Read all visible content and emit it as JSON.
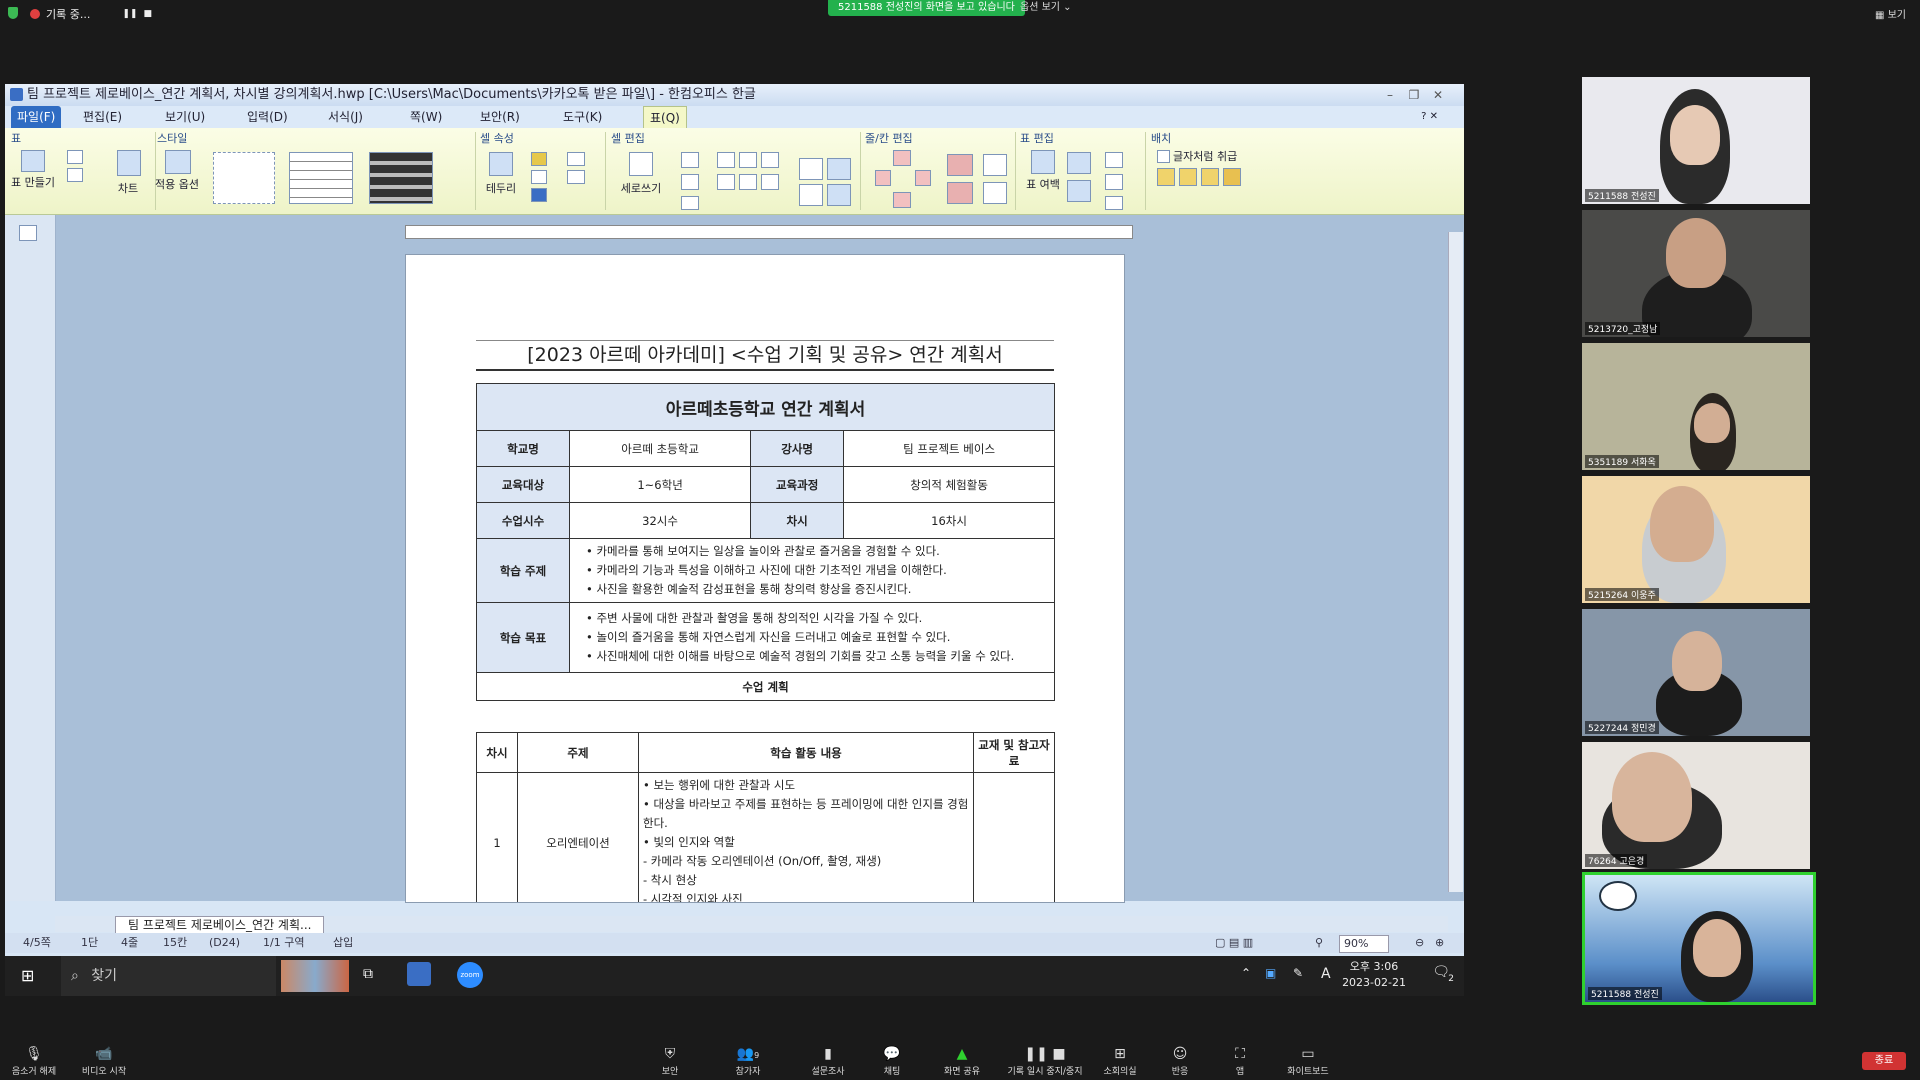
{
  "zoom_top": {
    "recording_label": "기록 중...",
    "share_banner": "5211588 전성진의 화면을 보고 있습니다",
    "view_options": "옵션 보기",
    "right_label": "보기"
  },
  "window": {
    "title": "팀 프로젝트 제로베이스_연간 계획서, 차시별 강의계획서.hwp [C:\\Users\\Mac\\Documents\\카카오톡 받은 파일\\] - 한컴오피스 한글"
  },
  "menu": {
    "items": [
      "파일(F)",
      "편집(E)",
      "보기(U)",
      "입력(D)",
      "서식(J)",
      "쪽(W)",
      "보안(R)",
      "도구(K)",
      "표(Q)"
    ]
  },
  "ribbon": {
    "groups": [
      "표",
      "스타일",
      "셀 속성",
      "셀 편집",
      "줄/칸 편집",
      "표 편집",
      "배치"
    ],
    "btn_make_table": "표 만들기",
    "btn_chart": "차트",
    "btn_apply_options": "적용 옵션",
    "btn_border": "테두리",
    "btn_vertical_write": "세로쓰기",
    "btn_table_margin": "표 여백",
    "chk_treat_as_char": "글자처럼 취급"
  },
  "document": {
    "header": "[2023 아르떼 아카데미] <수업 기획 및 공유> 연간 계획서",
    "table_title": "아르떼초등학교 연간 계획서",
    "rows": {
      "school_label": "학교명",
      "school_value": "아르떼 초등학교",
      "teacher_label": "강사명",
      "teacher_value": "팀 프로젝트 베이스",
      "target_label": "교육대상",
      "target_value": "1~6학년",
      "course_label": "교육과정",
      "course_value": "창의적 체험활동",
      "hours_label": "수업시수",
      "hours_value": "32시수",
      "sessions_label": "차시",
      "sessions_value": "16차시"
    },
    "topic_label": "학습 주제",
    "topics": [
      "카메라를 통해 보여지는 일상을 놀이와 관찰로 즐거움을 경험할 수 있다.",
      "카메라의 기능과 특성을 이해하고 사진에 대한 기초적인 개념을 이해한다.",
      "사진을 활용한 예술적 감성표현을 통해 창의력 향상을 증진시킨다."
    ],
    "goal_label": "학습 목표",
    "goals": [
      "주변 사물에 대한 관찰과 촬영을 통해 창의적인 시각을 가질 수 있다.",
      "놀이의 즐거움을 통해 자연스럽게 자신을 드러내고 예술로 표현할 수 있다.",
      "사진매체에 대한 이해를 바탕으로 예술적 경험의 기회를 갖고 소통 능력을 키울 수 있다."
    ],
    "plan_label": "수업 계획",
    "plan_headers": [
      "차시",
      "주제",
      "학습 활동 내용",
      "교재 및 참고자료"
    ],
    "plan_row1": {
      "num": "1",
      "topic": "오리엔테이션",
      "activities": [
        "• 보는 행위에 대한 관찰과 시도",
        "• 대상을 바라보고 주제를 표현하는 등 프레이밍에 대한 인지를 경험한다.",
        "• 빛의 인지와 역할",
        " - 카메라 작동 오리엔테이션 (On/Off, 촬영, 재생)",
        " - 착시 현상",
        " - 시각적 인지와 사진"
      ]
    }
  },
  "doc_tab": "팀 프로젝트 제로베이스_연간 계획...",
  "status": {
    "page": "4/5쪽",
    "column": "1단",
    "line": "4줄",
    "col": "15칸",
    "cell": "(D24)",
    "section": "1/1 구역",
    "mode": "삽입",
    "zoom": "90%"
  },
  "taskbar": {
    "search": "찾기",
    "time": "오후 3:06",
    "date": "2023-02-21",
    "notif_count": "2",
    "lang": "A"
  },
  "participants": [
    {
      "name": "5211588 전성진"
    },
    {
      "name": "5213720_고정남"
    },
    {
      "name": "5351189 서화옥"
    },
    {
      "name": "5215264 이웅주"
    },
    {
      "name": "5227244 정민경"
    },
    {
      "name": "76264 고은경"
    },
    {
      "name": "5211588 전성진"
    }
  ],
  "zoom_bottom": {
    "mute": "음소거 해제",
    "video": "비디오 시작",
    "security": "보안",
    "participants": "참가자",
    "participant_count": "9",
    "poll": "설문조사",
    "chat": "채팅",
    "share": "화면 공유",
    "pause_rec": "기록 일시 중지/중지",
    "breakout": "소회의실",
    "reactions": "반응",
    "apps": "앱",
    "whiteboard": "화이트보드",
    "end": "종료"
  }
}
